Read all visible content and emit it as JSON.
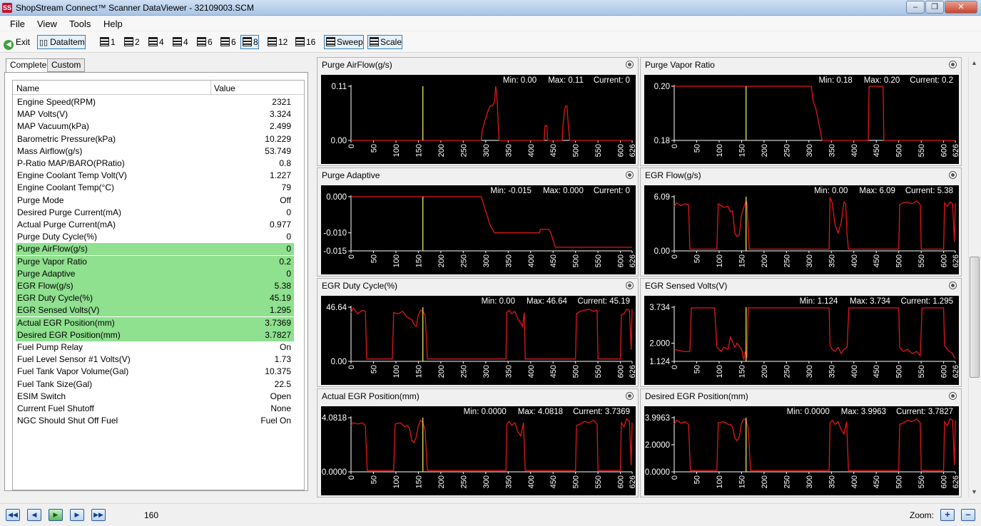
{
  "window": {
    "title": "ShopStream Connect™ Scanner DataViewer - 32109003.SCM",
    "icon_label": "SS",
    "minimize": "–",
    "maximize": "❐",
    "close": "✕"
  },
  "menu": [
    "File",
    "View",
    "Tools",
    "Help"
  ],
  "toolbar": {
    "exit": "Exit",
    "dataitem": "DataItem",
    "layouts": [
      "1",
      "2",
      "4",
      "4",
      "6",
      "6",
      "8",
      "12",
      "16"
    ],
    "sweep": "Sweep",
    "scale": "Scale"
  },
  "tabs": [
    "Complete",
    "Custom"
  ],
  "grid": {
    "headers": {
      "name": "Name",
      "value": "Value"
    },
    "rows": [
      {
        "name": "Engine Speed(RPM)",
        "value": "2321"
      },
      {
        "name": "MAP Volts(V)",
        "value": "3.324"
      },
      {
        "name": "MAP Vacuum(kPa)",
        "value": "2.499"
      },
      {
        "name": "Barometric Pressure(kPa)",
        "value": "10.229"
      },
      {
        "name": "Mass Airflow(g/s)",
        "value": "53.749"
      },
      {
        "name": "P-Ratio MAP/BARO(PRatio)",
        "value": "0.8"
      },
      {
        "name": "Engine Coolant Temp Volt(V)",
        "value": "1.227"
      },
      {
        "name": "Engine Coolant Temp(°C)",
        "value": "79"
      },
      {
        "name": "Purge Mode",
        "value": "Off"
      },
      {
        "name": "Desired Purge Current(mA)",
        "value": "0"
      },
      {
        "name": "Actual Purge Current(mA)",
        "value": "0.977"
      },
      {
        "name": "Purge Duty Cycle(%)",
        "value": "0"
      },
      {
        "name": "Purge AirFlow(g/s)",
        "value": "0"
      },
      {
        "name": "Purge Vapor Ratio",
        "value": "0.2"
      },
      {
        "name": "Purge Adaptive",
        "value": "0"
      },
      {
        "name": "EGR Flow(g/s)",
        "value": "5.38"
      },
      {
        "name": "EGR Duty Cycle(%)",
        "value": "45.19"
      },
      {
        "name": "EGR Sensed Volts(V)",
        "value": "1.295"
      },
      {
        "name": "Actual EGR Position(mm)",
        "value": "3.7369"
      },
      {
        "name": "Desired EGR Position(mm)",
        "value": "3.7827"
      },
      {
        "name": "Fuel Pump Relay",
        "value": "On"
      },
      {
        "name": "Fuel Level Sensor #1 Volts(V)",
        "value": "1.73"
      },
      {
        "name": "Fuel Tank Vapor Volume(Gal)",
        "value": "10.375"
      },
      {
        "name": "Fuel Tank Size(Gal)",
        "value": "22.5"
      },
      {
        "name": "ESIM Switch",
        "value": "Open"
      },
      {
        "name": "Current Fuel Shutoff",
        "value": "None"
      },
      {
        "name": "NGC Should Shut Off Fuel",
        "value": "Fuel On"
      }
    ],
    "selected_range": [
      12,
      19
    ]
  },
  "chart_data": [
    {
      "type": "line",
      "title": "Purge AirFlow(g/s)",
      "min_text": "Min: 0.00",
      "max_text": "Max: 0.11",
      "current_text": "Current: 0",
      "yticks": [
        "0.11",
        "0.00"
      ],
      "ylim": [
        0,
        0.11
      ],
      "xlim": [
        0,
        626
      ],
      "xticks": [
        "0",
        "50",
        "100",
        "150",
        "200",
        "250",
        "300",
        "350",
        "400",
        "450",
        "500",
        "550",
        "600",
        "626"
      ],
      "cursor_x": 160,
      "x": [
        0,
        290,
        292,
        298,
        305,
        310,
        315,
        320,
        322,
        324,
        326,
        328,
        330,
        335,
        340,
        430,
        432,
        434,
        436,
        438,
        445,
        470,
        472,
        475,
        478,
        481,
        484,
        487,
        626
      ],
      "y": [
        0,
        0,
        0.02,
        0.04,
        0.06,
        0.07,
        0.07,
        0.08,
        0.11,
        0.1,
        0.07,
        0.03,
        0,
        0,
        0,
        0,
        0.03,
        0.03,
        0.03,
        0,
        0,
        0,
        0.03,
        0.06,
        0.07,
        0.07,
        0.03,
        0,
        0
      ]
    },
    {
      "type": "line",
      "title": "Purge Vapor Ratio",
      "min_text": "Min: 0.18",
      "max_text": "Max: 0.20",
      "current_text": "Current: 0.2",
      "yticks": [
        "0.20",
        "0.18"
      ],
      "ylim": [
        0.18,
        0.2
      ],
      "xlim": [
        0,
        626
      ],
      "xticks": [
        "0",
        "50",
        "100",
        "150",
        "200",
        "250",
        "300",
        "350",
        "400",
        "450",
        "500",
        "550",
        "600",
        "626"
      ],
      "cursor_x": 160,
      "x": [
        0,
        305,
        310,
        315,
        320,
        325,
        328,
        330,
        432,
        434,
        465,
        467,
        626
      ],
      "y": [
        0.2,
        0.2,
        0.194,
        0.192,
        0.188,
        0.184,
        0.181,
        0.18,
        0.18,
        0.2,
        0.2,
        0.18,
        0.18
      ]
    },
    {
      "type": "line",
      "title": "Purge Adaptive",
      "min_text": "Min: -0.015",
      "max_text": "Max: 0.000",
      "current_text": "Current: 0",
      "yticks": [
        "0.000",
        "-0.010",
        "-0.015"
      ],
      "ylim": [
        -0.015,
        0
      ],
      "xlim": [
        0,
        626
      ],
      "xticks": [
        "0",
        "50",
        "100",
        "150",
        "200",
        "250",
        "300",
        "350",
        "400",
        "450",
        "500",
        "550",
        "600",
        "626"
      ],
      "cursor_x": 160,
      "x": [
        0,
        290,
        295,
        300,
        305,
        310,
        315,
        320,
        330,
        420,
        422,
        440,
        445,
        450,
        455,
        470,
        626
      ],
      "y": [
        0,
        0,
        -0.002,
        -0.004,
        -0.006,
        -0.008,
        -0.009,
        -0.01,
        -0.01,
        -0.01,
        -0.009,
        -0.009,
        -0.01,
        -0.012,
        -0.014,
        -0.014,
        -0.014
      ]
    },
    {
      "type": "line",
      "title": "EGR Flow(g/s)",
      "min_text": "Min: 0.00",
      "max_text": "Max: 6.09",
      "current_text": "Current: 5.38",
      "yticks": [
        "6.09",
        "0.00"
      ],
      "ylim": [
        0,
        6.09
      ],
      "xlim": [
        0,
        626
      ],
      "xticks": [
        "0",
        "50",
        "100",
        "150",
        "200",
        "250",
        "300",
        "350",
        "400",
        "450",
        "500",
        "550",
        "600",
        "626"
      ],
      "cursor_x": 160,
      "x": [
        0,
        5,
        15,
        25,
        32,
        35,
        95,
        98,
        110,
        120,
        125,
        130,
        135,
        140,
        145,
        150,
        155,
        160,
        162,
        165,
        167,
        345,
        347,
        352,
        358,
        365,
        372,
        378,
        382,
        385,
        388,
        392,
        396,
        400,
        500,
        502,
        510,
        520,
        530,
        540,
        548,
        550,
        555,
        600,
        602,
        608,
        614,
        620,
        624,
        626
      ],
      "y": [
        5.0,
        5.4,
        5.1,
        5.3,
        5.2,
        0.2,
        0.2,
        5.3,
        4.9,
        5.0,
        4.4,
        4.5,
        2.0,
        1.6,
        1.8,
        4.1,
        4.9,
        5.6,
        5.4,
        2.5,
        0.2,
        0.2,
        6.0,
        5.4,
        3.0,
        2.0,
        3.2,
        5.5,
        5.3,
        1.8,
        0.2,
        0.2,
        0.2,
        0.2,
        0.2,
        5.2,
        5.4,
        5.5,
        5.3,
        5.6,
        5.2,
        0.2,
        0.2,
        0.2,
        5.4,
        5.0,
        5.5,
        5.3,
        1.0,
        5.4
      ]
    },
    {
      "type": "line",
      "title": "EGR Duty Cycle(%)",
      "min_text": "Min: 0.00",
      "max_text": "Max: 46.64",
      "current_text": "Current: 45.19",
      "yticks": [
        "46.64",
        "0.00"
      ],
      "ylim": [
        0,
        46.64
      ],
      "xlim": [
        0,
        626
      ],
      "xticks": [
        "0",
        "50",
        "100",
        "150",
        "200",
        "250",
        "300",
        "350",
        "400",
        "450",
        "500",
        "550",
        "600",
        "626"
      ],
      "cursor_x": 160,
      "x": [
        0,
        5,
        15,
        25,
        32,
        35,
        92,
        95,
        105,
        115,
        125,
        135,
        140,
        145,
        150,
        155,
        160,
        165,
        168,
        170,
        345,
        347,
        352,
        358,
        365,
        372,
        378,
        382,
        386,
        388,
        500,
        502,
        510,
        520,
        530,
        540,
        548,
        550,
        600,
        602,
        608,
        614,
        620,
        624,
        626
      ],
      "y": [
        42,
        46,
        41,
        44,
        43,
        2,
        2,
        42,
        41,
        43,
        38,
        36,
        32,
        30,
        40,
        44,
        43,
        40,
        20,
        2,
        2,
        42,
        44,
        41,
        43,
        36,
        33,
        30,
        42,
        2,
        2,
        41,
        43,
        44,
        45,
        43,
        44,
        2,
        2,
        40,
        41,
        45,
        44,
        10,
        45
      ]
    },
    {
      "type": "line",
      "title": "EGR Sensed Volts(V)",
      "min_text": "Min: 1.124",
      "max_text": "Max: 3.734",
      "current_text": "Current: 1.295",
      "yticks": [
        "3.734",
        "2.000",
        "1.124"
      ],
      "ylim": [
        1.124,
        3.734
      ],
      "xlim": [
        0,
        626
      ],
      "xticks": [
        "0",
        "50",
        "100",
        "150",
        "200",
        "250",
        "300",
        "350",
        "400",
        "450",
        "500",
        "550",
        "600",
        "626"
      ],
      "cursor_x": 160,
      "x": [
        0,
        20,
        35,
        38,
        90,
        95,
        105,
        110,
        120,
        125,
        135,
        140,
        150,
        155,
        158,
        162,
        165,
        175,
        345,
        347,
        352,
        358,
        365,
        372,
        378,
        385,
        389,
        500,
        502,
        510,
        520,
        530,
        540,
        548,
        552,
        600,
        602,
        608,
        614,
        620,
        624,
        626
      ],
      "y": [
        1.7,
        1.6,
        1.6,
        3.7,
        3.7,
        1.8,
        1.6,
        1.8,
        1.7,
        2.3,
        1.8,
        2.0,
        1.7,
        1.2,
        1.6,
        1.3,
        3.7,
        3.7,
        3.7,
        1.9,
        1.7,
        1.6,
        1.8,
        1.5,
        1.7,
        1.8,
        3.7,
        3.7,
        1.8,
        1.6,
        1.7,
        1.5,
        1.6,
        1.4,
        3.7,
        3.7,
        1.9,
        1.7,
        1.6,
        1.5,
        1.3,
        1.3
      ]
    },
    {
      "type": "line",
      "title": "Actual EGR Position(mm)",
      "min_text": "Min: 0.0000",
      "max_text": "Max: 4.0818",
      "current_text": "Current: 3.7369",
      "yticks": [
        "4.0818",
        "0.0000"
      ],
      "ylim": [
        0,
        4.0818
      ],
      "xlim": [
        0,
        626
      ],
      "xticks": [
        "0",
        "50",
        "100",
        "150",
        "200",
        "250",
        "300",
        "350",
        "400",
        "450",
        "500",
        "550",
        "600",
        "626"
      ],
      "cursor_x": 160,
      "x": [
        0,
        5,
        15,
        25,
        32,
        36,
        95,
        98,
        110,
        120,
        125,
        130,
        135,
        140,
        145,
        150,
        155,
        160,
        165,
        170,
        345,
        347,
        352,
        358,
        365,
        372,
        378,
        384,
        388,
        500,
        502,
        510,
        520,
        530,
        540,
        548,
        550,
        600,
        602,
        608,
        614,
        620,
        624,
        626
      ],
      "y": [
        3.5,
        3.7,
        3.6,
        3.7,
        3.5,
        0.1,
        0.1,
        3.6,
        3.7,
        3.4,
        3.5,
        3.3,
        2.4,
        2.2,
        2.6,
        3.5,
        3.9,
        3.7,
        3.2,
        0.1,
        0.1,
        3.6,
        3.8,
        3.5,
        3.7,
        3.0,
        2.7,
        3.7,
        0.1,
        0.1,
        3.5,
        3.6,
        3.8,
        3.7,
        3.9,
        3.6,
        0.1,
        0.1,
        3.7,
        3.4,
        4.0,
        3.8,
        0.5,
        3.7
      ]
    },
    {
      "type": "line",
      "title": "Desired EGR Position(mm)",
      "min_text": "Min: 0.0000",
      "max_text": "Max: 3.9963",
      "current_text": "Current: 3.7827",
      "yticks": [
        "3.9963",
        "2.0000",
        "0.0000"
      ],
      "ylim": [
        0,
        3.9963
      ],
      "xlim": [
        0,
        626
      ],
      "xticks": [
        "0",
        "50",
        "100",
        "150",
        "200",
        "250",
        "300",
        "350",
        "400",
        "450",
        "500",
        "550",
        "600",
        "626"
      ],
      "cursor_x": 160,
      "x": [
        0,
        5,
        15,
        25,
        32,
        36,
        95,
        98,
        110,
        120,
        125,
        130,
        135,
        140,
        145,
        150,
        155,
        160,
        165,
        170,
        345,
        347,
        352,
        358,
        365,
        372,
        378,
        384,
        388,
        500,
        502,
        510,
        520,
        530,
        540,
        548,
        550,
        600,
        602,
        608,
        614,
        620,
        624,
        626
      ],
      "y": [
        3.5,
        3.8,
        3.6,
        3.7,
        3.5,
        0.1,
        0.1,
        3.6,
        3.7,
        3.5,
        3.5,
        3.3,
        2.5,
        2.3,
        2.6,
        3.6,
        3.9,
        3.8,
        3.2,
        0.1,
        0.1,
        3.6,
        3.8,
        3.5,
        3.7,
        3.1,
        2.8,
        3.7,
        0.1,
        0.1,
        3.5,
        3.6,
        3.8,
        3.7,
        3.9,
        3.6,
        0.1,
        0.1,
        3.7,
        3.4,
        3.9,
        3.8,
        0.5,
        3.8
      ]
    }
  ],
  "status": {
    "frame": "160",
    "zoom_label": "Zoom:",
    "nav": [
      "◀◀",
      "◀",
      "▶",
      "▶",
      "▶▶"
    ],
    "zoom_in": "+",
    "zoom_out": "–"
  },
  "scroll": {
    "up": "▲",
    "down": "▼"
  }
}
